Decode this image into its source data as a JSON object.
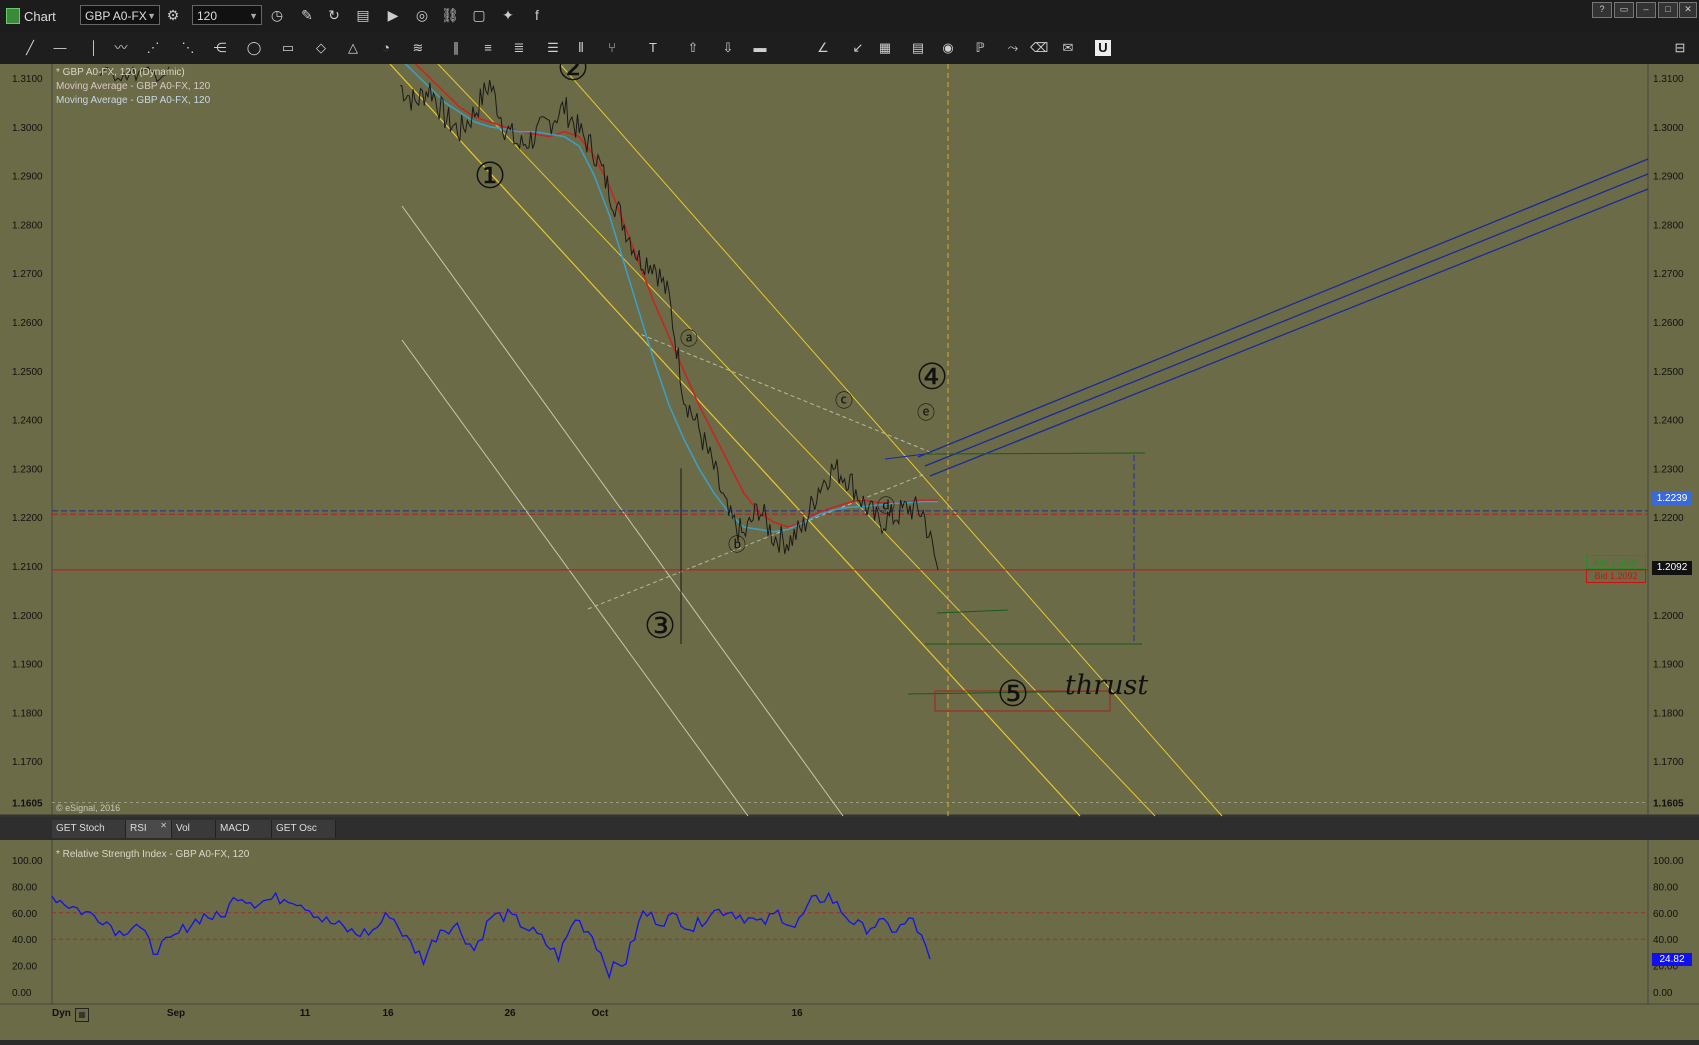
{
  "window": {
    "title": "Chart",
    "symbol": "GBP A0-FX",
    "interval": "120",
    "window_buttons": [
      "?",
      "▭",
      "–",
      "□",
      "✕"
    ]
  },
  "toolbar_icons": [
    "line-tool-icon",
    "horizontal-line-icon",
    "vertical-line-icon",
    "freehand-icon",
    "fib-fan-icon",
    "gann-fan-icon",
    "speed-lines-icon",
    "ellipse-icon",
    "rectangle-icon",
    "eraser-shape-icon",
    "triangle-icon",
    "fib-arcs-icon",
    "elliott-wave-icon",
    "parallel-lines-icon",
    "cycle-icon",
    "fib-retracement-icon",
    "fib-extension-icon",
    "fib-time-icon",
    "andrews-fork-icon",
    "text-tool-icon",
    "up-arrow-icon",
    "down-arrow-icon",
    "bars-icon",
    "angle-icon",
    "ray-icon",
    "grid-icon",
    "mob-icon",
    "circle-tool-icon",
    "pti-icon",
    "trend-projection-icon",
    "eraser-icon",
    "comment-icon",
    "magnet-icon"
  ],
  "colors": {
    "chart_bg": "#6b6b47",
    "price_line": "#1a1a1a",
    "ma_red": "#cc2222",
    "ma_blue": "#3aa0c8",
    "channel_yellow": "#e8c830",
    "channel_white": "#c8c8b0",
    "fan_blue": "#1a2a99",
    "rsi_blue": "#1111ee",
    "bid_red": "#cc1111",
    "ask_green": "#2a8a2a"
  },
  "legend": {
    "line1": "* GBP A0-FX, 120 (Dynamic)",
    "line2": "Moving Average - GBP A0-FX, 120",
    "line3": "Moving Average - GBP A0-FX, 120",
    "copyright": "© eSignal, 2016"
  },
  "price_axis_ticks": [
    "1.3100",
    "1.3000",
    "1.2900",
    "1.2800",
    "1.2700",
    "1.2600",
    "1.2500",
    "1.2400",
    "1.2300",
    "1.2200",
    "1.2100",
    "1.2000",
    "1.1900",
    "1.1800",
    "1.1700"
  ],
  "price_axis_low": "1.1605",
  "labels": {
    "current_price": "1.2239",
    "bid_price": "1.2092",
    "ask_tag": "Ask 1.2094",
    "bid_tag": "Bid 1.2092",
    "thrust": "thrust",
    "waves": {
      "w1": "①",
      "w2": "②",
      "w3": "③",
      "w4": "④",
      "w5": "⑤"
    },
    "subwaves": {
      "a": "ⓐ",
      "b": "ⓑ",
      "c": "ⓒ",
      "d": "ⓓ",
      "e": "ⓔ"
    }
  },
  "x_axis": {
    "corner_label": "Dyn",
    "ticks": [
      "Sep",
      "11",
      "16",
      "26",
      "Oct",
      "16"
    ]
  },
  "indicator_tabs": [
    "GET Stoch",
    "RSI",
    "Vol",
    "MACD",
    "GET Osc"
  ],
  "rsi": {
    "title": "* Relative Strength Index - GBP A0-FX, 120",
    "axis_ticks": [
      "100.00",
      "80.00",
      "60.00",
      "40.00",
      "20.00",
      "0.00"
    ],
    "value": "24.82",
    "overbought": 60,
    "oversold": 40
  },
  "chart_data": {
    "type": "line",
    "title": "",
    "ylim": [
      1.1605,
      1.315
    ],
    "grid": false,
    "series": [
      {
        "name": "GBP A0-FX, 120",
        "values": [
          1.3085,
          1.305,
          1.308,
          1.302,
          1.299,
          1.303,
          1.309,
          1.3,
          1.296,
          1.298,
          1.301,
          1.304,
          1.299,
          1.295,
          1.287,
          1.28,
          1.273,
          1.272,
          1.265,
          1.245,
          1.238,
          1.23,
          1.22,
          1.216,
          1.222,
          1.216,
          1.215,
          1.218,
          1.226,
          1.23,
          1.228,
          1.223,
          1.219,
          1.22,
          1.222,
          1.221,
          1.2092
        ]
      },
      {
        "name": "Moving Average - GBP A0-FX, 120",
        "values": [
          1.316,
          1.313,
          1.31,
          1.307,
          1.304,
          1.302,
          1.301,
          1.3,
          1.299,
          1.2985,
          1.298,
          1.299,
          1.298,
          1.294,
          1.288,
          1.28,
          1.272,
          1.264,
          1.257,
          1.25,
          1.243,
          1.237,
          1.231,
          1.225,
          1.221,
          1.219,
          1.218,
          1.219,
          1.221,
          1.222,
          1.223,
          1.2235,
          1.223,
          1.2228,
          1.2232,
          1.2235,
          1.2235
        ]
      },
      {
        "name": "Moving Average - GBP A0-FX, 120",
        "values": [
          1.314,
          1.311,
          1.308,
          1.305,
          1.303,
          1.301,
          1.3,
          1.2995,
          1.299,
          1.299,
          1.2985,
          1.298,
          1.296,
          1.29,
          1.282,
          1.272,
          1.262,
          1.252,
          1.243,
          1.236,
          1.23,
          1.225,
          1.221,
          1.218,
          1.2175,
          1.217,
          1.2175,
          1.219,
          1.2205,
          1.2215,
          1.222,
          1.2222,
          1.2225,
          1.2228,
          1.223,
          1.2232,
          1.2232
        ]
      }
    ],
    "rsi_values": [
      73,
      66,
      60,
      56,
      45,
      52,
      32,
      38,
      50,
      58,
      56,
      74,
      68,
      70,
      72,
      66,
      55,
      50,
      44,
      46,
      60,
      40,
      25,
      48,
      50,
      32,
      57,
      58,
      50,
      40,
      27,
      56,
      43,
      16,
      24,
      60,
      54,
      57,
      48,
      61,
      62,
      57,
      51,
      60,
      49,
      68,
      73,
      58,
      48,
      52,
      47,
      55,
      25
    ]
  }
}
